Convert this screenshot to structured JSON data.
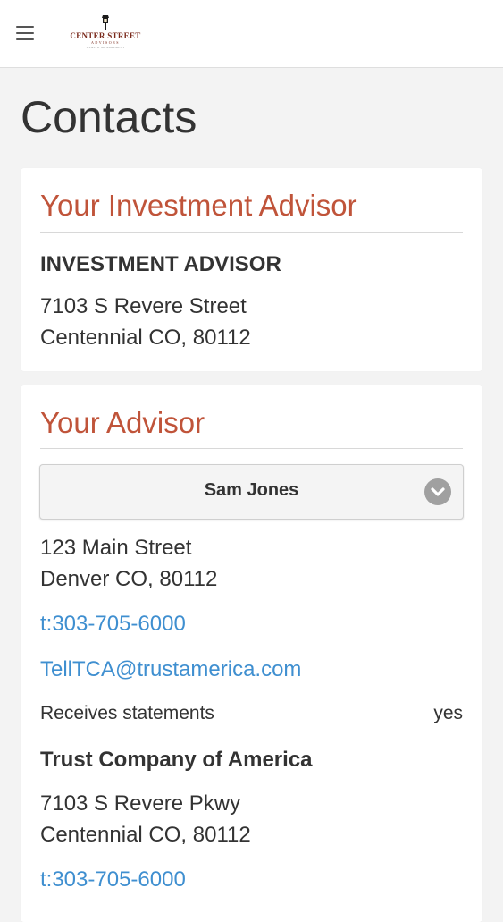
{
  "header": {
    "logo": {
      "line1": "CENTER STREET",
      "line2": "ADVISORS",
      "line3": "WEALTH MANAGEMENT"
    }
  },
  "page": {
    "title": "Contacts"
  },
  "investment_advisor": {
    "heading": "Your Investment Advisor",
    "name": "INVESTMENT ADVISOR",
    "address_line1": "7103 S Revere Street",
    "address_line2": "Centennial CO, 80112"
  },
  "advisor": {
    "heading": "Your Advisor",
    "selected": "Sam Jones",
    "address_line1": "123 Main Street",
    "address_line2": "Denver CO, 80112",
    "phone": "t:303-705-6000",
    "email": "TellTCA@trustamerica.com",
    "receives_label": "Receives statements",
    "receives_value": "yes"
  },
  "custodian": {
    "name": "Trust Company of America",
    "address_line1": "7103 S Revere Pkwy",
    "address_line2": "Centennial CO, 80112",
    "phone": "t:303-705-6000"
  },
  "colors": {
    "accent_heading": "#c0543a",
    "link": "#3f8fd0",
    "background": "#f3f3f3",
    "logo": "#7a2a1c"
  },
  "icons": {
    "menu": "hamburger-menu-icon",
    "logo_lamp": "lamp-post-icon",
    "select": "chevron-down-circle-icon"
  }
}
